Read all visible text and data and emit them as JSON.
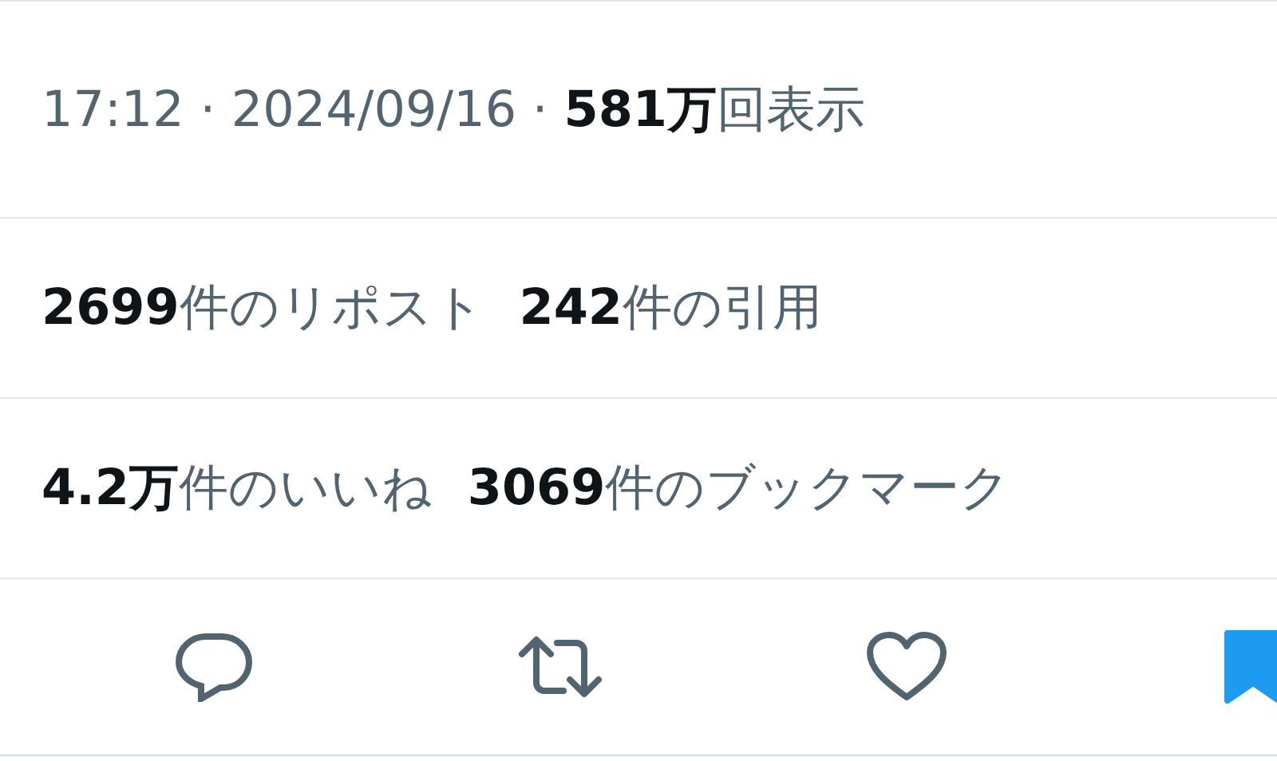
{
  "timestamp": "17:12 · 2024/09/16 ·",
  "views": "**581万**回表示",
  "stat_rows": [
    [
      {
        "text": "**2699**件のリポスト"
      },
      {
        "text": "**242**件の引用"
      }
    ],
    [
      {
        "text": "**4.2万**件のいいね"
      },
      {
        "text": "**3069**件のブックマーク"
      }
    ]
  ],
  "actions": [
    {
      "kind": "reply",
      "selected": false
    },
    {
      "kind": "repost",
      "selected": false
    },
    {
      "kind": "like",
      "selected": false
    },
    {
      "kind": "bookmark",
      "selected": true
    }
  ]
}
